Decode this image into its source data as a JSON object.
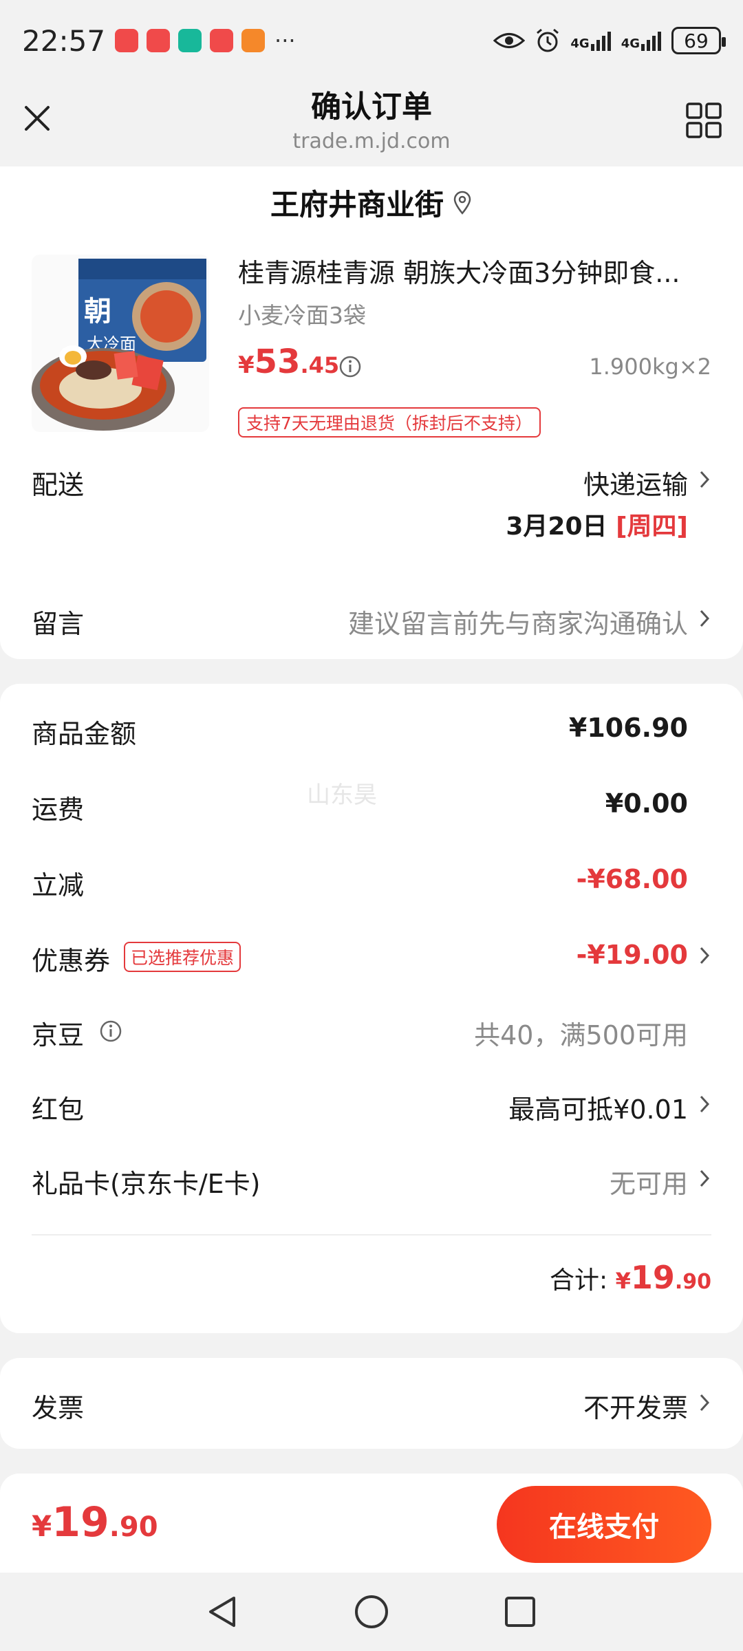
{
  "status_bar": {
    "time": "22:57",
    "battery": "69",
    "net_1": "4G",
    "net_2": "4G",
    "dots": "···"
  },
  "nav": {
    "title": "确认订单",
    "url": "trade.m.jd.com"
  },
  "address": {
    "text": "王府井商业街"
  },
  "product": {
    "title": "桂青源桂青源 朝族大冷面3分钟即食...",
    "spec": "小麦冷面3袋",
    "price_currency": "¥",
    "price_int": "53",
    "price_dec": ".45",
    "weight": "1.900kg×2",
    "return_tag": "支持7天无理由退货（拆封后不支持）"
  },
  "delivery": {
    "label": "配送",
    "method": "快递运输",
    "date": "3月20日",
    "weekday": "[周四]"
  },
  "message": {
    "label": "留言",
    "placeholder": "建议留言前先与商家沟通确认"
  },
  "summary": {
    "goods_label": "商品金额",
    "goods_value": "¥106.90",
    "shipping_label": "运费",
    "shipping_value": "¥0.00",
    "discount_label": "立减",
    "discount_value": "-¥68.00",
    "coupon_label": "优惠券",
    "coupon_tag": "已选推荐优惠",
    "coupon_value": "-¥19.00",
    "jingdou_label": "京豆",
    "jingdou_value": "共40，满500可用",
    "redpacket_label": "红包",
    "redpacket_value": "最高可抵¥0.01",
    "giftcard_label": "礼品卡(京东卡/E卡)",
    "giftcard_value": "无可用",
    "total_label": "合计:",
    "total_currency": "¥",
    "total_int": "19",
    "total_dec": ".90"
  },
  "watermark": "山东昊",
  "invoice": {
    "label": "发票",
    "value": "不开发票"
  },
  "pay": {
    "currency": "¥",
    "int": "19",
    "dec": ".90",
    "button": "在线支付"
  },
  "colors": {
    "accent": "#e4393c",
    "pay_button": "#f5361f"
  }
}
